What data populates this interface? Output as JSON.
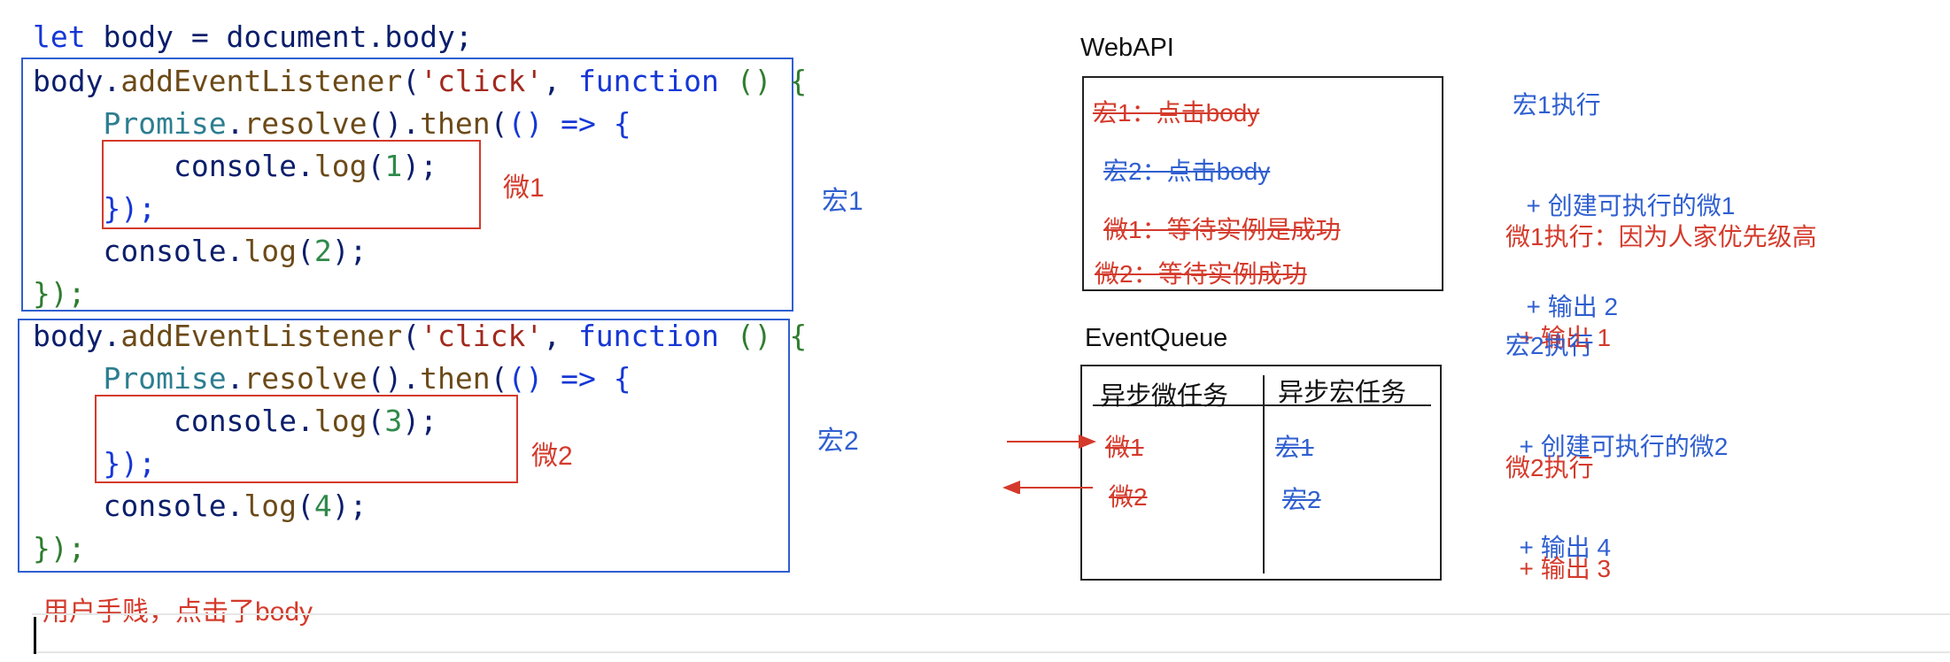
{
  "code": {
    "line1": {
      "kw": "let",
      "rest": " body = document.body;"
    },
    "handler1": {
      "l1": {
        "a": "body.",
        "fn": "addEventListener",
        "b": "(",
        "str": "'click'",
        "c": ", ",
        "kw": "function",
        "d": " ",
        "p": "() {"
      },
      "l2": {
        "cls": "Promise",
        "a": ".",
        "fn1": "resolve",
        "b": "().",
        "fn2": "then",
        "c": "(",
        "p": "()",
        "kw": " => {"
      },
      "l3": {
        "a": "console.",
        "fn": "log",
        "b": "(",
        "num": "1",
        "c": ");"
      },
      "l4": {
        "a": "});"
      },
      "l5": {
        "a": "console.",
        "fn": "log",
        "b": "(",
        "num": "2",
        "c": ");"
      },
      "l6": {
        "a": "});"
      }
    },
    "handler2": {
      "l1": {
        "a": "body.",
        "fn": "addEventListener",
        "b": "(",
        "str": "'click'",
        "c": ", ",
        "kw": "function",
        "d": " ",
        "p": "() {"
      },
      "l2": {
        "cls": "Promise",
        "a": ".",
        "fn1": "resolve",
        "b": "().",
        "fn2": "then",
        "c": "(",
        "p": "()",
        "kw": " => {"
      },
      "l3": {
        "a": "console.",
        "fn": "log",
        "b": "(",
        "num": "3",
        "c": ");"
      },
      "l4": {
        "a": "});"
      },
      "l5": {
        "a": "console.",
        "fn": "log",
        "b": "(",
        "num": "4",
        "c": ");"
      },
      "l6": {
        "a": "});"
      }
    }
  },
  "labels": {
    "micro1": "微1",
    "micro2": "微2",
    "macro1": "宏1",
    "macro2": "宏2",
    "user_click": "用户手贱，点击了body"
  },
  "webapi": {
    "title": "WebAPI",
    "items": [
      "宏1：点击body",
      "宏2：点击body",
      "微1：等待实例是成功",
      "微2：等待实例成功"
    ]
  },
  "event_queue": {
    "title": "EventQueue",
    "col_micro": "异步微任务",
    "col_macro": "异步宏任务",
    "micro_items": [
      "微1",
      "微2"
    ],
    "macro_items": [
      "宏1",
      "宏2"
    ]
  },
  "notes": {
    "macro1": [
      "宏1执行",
      "  + 创建可执行的微1",
      "  + 输出 2"
    ],
    "micro1": [
      "微1执行：因为人家优先级高",
      "  + 输出 1"
    ],
    "macro2": [
      "宏2执行",
      "  + 创建可执行的微2",
      "  + 输出 4"
    ],
    "micro2": [
      "微2执行",
      "  + 输出 3"
    ]
  },
  "colors": {
    "red": "#d43a2b",
    "blue": "#2f5fd0"
  }
}
